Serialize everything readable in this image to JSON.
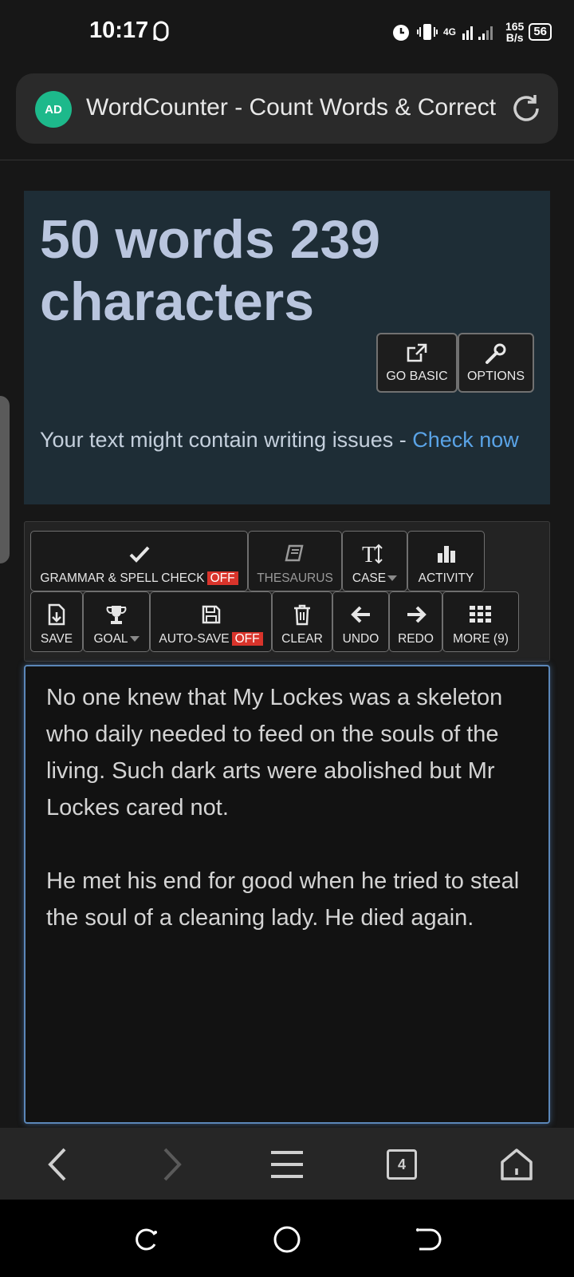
{
  "status_bar": {
    "time": "10:17",
    "network": "4G",
    "speed_value": "165",
    "speed_unit": "B/s",
    "battery": "56"
  },
  "browser": {
    "ad_badge": "AD",
    "page_title": "WordCounter - Count Words & Correct"
  },
  "hero": {
    "count_title": "50 words 239 characters",
    "go_basic_label": "GO BASIC",
    "options_label": "OPTIONS",
    "issues_text": "Your text might contain writing issues - ",
    "check_now_label": "Check now"
  },
  "toolbar": {
    "grammar_label": "GRAMMAR & SPELL CHECK",
    "grammar_state": "OFF",
    "thesaurus_label": "THESAURUS",
    "case_label": "CASE",
    "activity_label": "ACTIVITY",
    "save_label": "SAVE",
    "goal_label": "GOAL",
    "autosave_label": "AUTO-SAVE",
    "autosave_state": "OFF",
    "clear_label": "CLEAR",
    "undo_label": "UNDO",
    "redo_label": "REDO",
    "more_label": "MORE (9)"
  },
  "editor": {
    "paragraph_1": "No one knew that My Lockes was a skeleton who daily needed to feed on the souls of the living. Such dark arts were abolished but Mr Lockes cared not.",
    "paragraph_2": "He met his end for good when he tried to steal the soul of a cleaning lady. He died again."
  },
  "bottom_nav": {
    "tab_count": "4"
  },
  "colors": {
    "hero_bg": "#1e2d36",
    "count_title": "#b9c5de",
    "link": "#5aa3e6",
    "off_badge": "#d9342b",
    "editor_border": "#5b87b8"
  }
}
